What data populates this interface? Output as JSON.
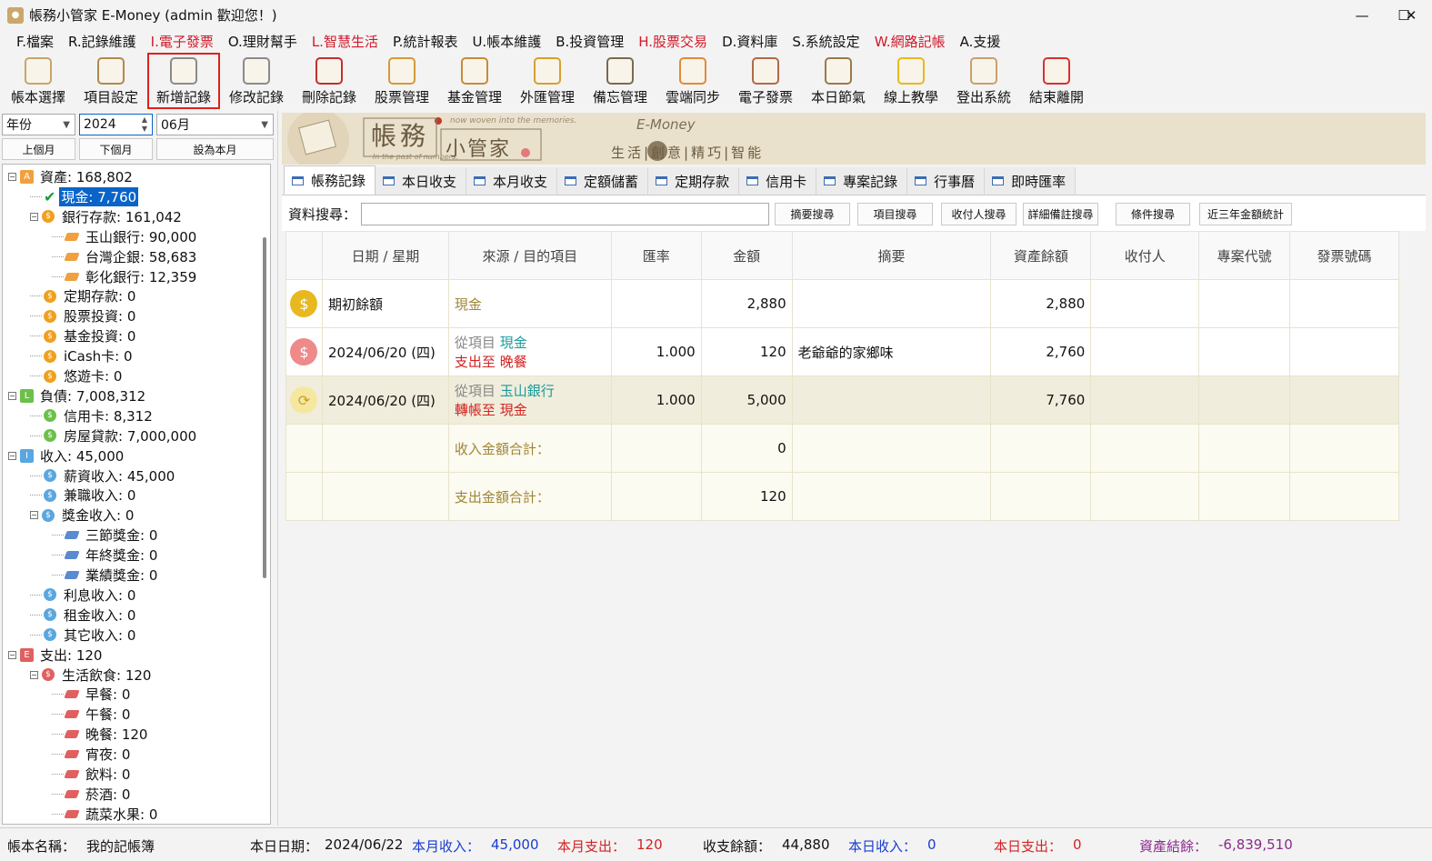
{
  "window": {
    "title": "帳務小管家 E-Money (admin 歡迎您！)",
    "minimize": "—",
    "maximize": "☐",
    "close": "✕"
  },
  "menu": [
    {
      "label": "F.檔案",
      "red": false
    },
    {
      "label": "R.記錄維護",
      "red": false
    },
    {
      "label": "I.電子發票",
      "red": true
    },
    {
      "label": "O.理財幫手",
      "red": false
    },
    {
      "label": "L.智慧生活",
      "red": true
    },
    {
      "label": "P.統計報表",
      "red": false
    },
    {
      "label": "U.帳本維護",
      "red": false
    },
    {
      "label": "B.投資管理",
      "red": false
    },
    {
      "label": "H.股票交易",
      "red": true
    },
    {
      "label": "D.資料庫",
      "red": false
    },
    {
      "label": "S.系統設定",
      "red": false
    },
    {
      "label": "W.網路記帳",
      "red": true
    },
    {
      "label": "A.支援",
      "red": false
    }
  ],
  "toolbar": [
    {
      "label": "帳本選擇",
      "icon": "ledger-icon",
      "color": "#c7a56a"
    },
    {
      "label": "項目設定",
      "icon": "gear-doc-icon",
      "color": "#b08a4a"
    },
    {
      "label": "新增記錄",
      "icon": "add-doc-icon",
      "color": "#8a8a8a"
    },
    {
      "label": "修改記錄",
      "icon": "edit-doc-icon",
      "color": "#8a8a8a"
    },
    {
      "label": "刪除記錄",
      "icon": "delete-doc-icon",
      "color": "#c03030"
    },
    {
      "label": "股票管理",
      "icon": "stock-icon",
      "color": "#d49a3a"
    },
    {
      "label": "基金管理",
      "icon": "fund-icon",
      "color": "#c88a3a"
    },
    {
      "label": "外匯管理",
      "icon": "forex-icon",
      "color": "#d8a030"
    },
    {
      "label": "備忘管理",
      "icon": "memo-icon",
      "color": "#7a6a50"
    },
    {
      "label": "雲端同步",
      "icon": "cloud-icon",
      "color": "#e08a3a"
    },
    {
      "label": "電子發票",
      "icon": "qrcode-icon",
      "color": "#b06a4a"
    },
    {
      "label": "本日節氣",
      "icon": "solar-term-icon",
      "color": "#9a7a4a"
    },
    {
      "label": "線上教學",
      "icon": "help-icon",
      "color": "#e8b820"
    },
    {
      "label": "登出系統",
      "icon": "logout-icon",
      "color": "#c8a070"
    },
    {
      "label": "結束離開",
      "icon": "exit-icon",
      "color": "#d83030"
    }
  ],
  "period": {
    "type": "年份",
    "year": "2024",
    "month": "06月",
    "prev": "上個月",
    "next": "下個月",
    "current": "設為本月"
  },
  "tree": [
    {
      "label": "資產: 168,802",
      "level": 0,
      "icon": "A",
      "color": "#f0a040",
      "exp": "−"
    },
    {
      "label": "現金: 7,760",
      "level": 1,
      "icon": "check",
      "color": "#1a9a3a",
      "hl": true
    },
    {
      "label": "銀行存款: 161,042",
      "level": 1,
      "icon": "coin",
      "color": "#f0a020",
      "exp": "−"
    },
    {
      "label": "玉山銀行: 90,000",
      "level": 2,
      "icon": "tag",
      "color": "#f0a040"
    },
    {
      "label": "台灣企銀: 58,683",
      "level": 2,
      "icon": "tag",
      "color": "#f0a040"
    },
    {
      "label": "彰化銀行: 12,359",
      "level": 2,
      "icon": "tag",
      "color": "#f0a040"
    },
    {
      "label": "定期存款: 0",
      "level": 1,
      "icon": "coin",
      "color": "#f0a020"
    },
    {
      "label": "股票投資: 0",
      "level": 1,
      "icon": "coin",
      "color": "#f0a020"
    },
    {
      "label": "基金投資: 0",
      "level": 1,
      "icon": "coin",
      "color": "#f0a020"
    },
    {
      "label": "iCash卡: 0",
      "level": 1,
      "icon": "coin",
      "color": "#f0a020"
    },
    {
      "label": "悠遊卡: 0",
      "level": 1,
      "icon": "coin",
      "color": "#f0a020"
    },
    {
      "label": "負債: 7,008,312",
      "level": 0,
      "icon": "L",
      "color": "#6cc04a",
      "exp": "−"
    },
    {
      "label": "信用卡: 8,312",
      "level": 1,
      "icon": "coin",
      "color": "#6cc04a"
    },
    {
      "label": "房屋貸款: 7,000,000",
      "level": 1,
      "icon": "coin",
      "color": "#6cc04a"
    },
    {
      "label": "收入: 45,000",
      "level": 0,
      "icon": "I",
      "color": "#5aa6e0",
      "exp": "−"
    },
    {
      "label": "薪資收入: 45,000",
      "level": 1,
      "icon": "coin",
      "color": "#5aa6e0"
    },
    {
      "label": "兼職收入: 0",
      "level": 1,
      "icon": "coin",
      "color": "#5aa6e0"
    },
    {
      "label": "獎金收入: 0",
      "level": 1,
      "icon": "coin",
      "color": "#5aa6e0",
      "exp": "−"
    },
    {
      "label": "三節獎金: 0",
      "level": 2,
      "icon": "tag",
      "color": "#5a8ad0"
    },
    {
      "label": "年終獎金: 0",
      "level": 2,
      "icon": "tag",
      "color": "#5a8ad0"
    },
    {
      "label": "業績獎金: 0",
      "level": 2,
      "icon": "tag",
      "color": "#5a8ad0"
    },
    {
      "label": "利息收入: 0",
      "level": 1,
      "icon": "coin",
      "color": "#5aa6e0"
    },
    {
      "label": "租金收入: 0",
      "level": 1,
      "icon": "coin",
      "color": "#5aa6e0"
    },
    {
      "label": "其它收入: 0",
      "level": 1,
      "icon": "coin",
      "color": "#5aa6e0"
    },
    {
      "label": "支出: 120",
      "level": 0,
      "icon": "E",
      "color": "#e06060",
      "exp": "−"
    },
    {
      "label": "生活飲食: 120",
      "level": 1,
      "icon": "coin",
      "color": "#e06060",
      "exp": "−"
    },
    {
      "label": "早餐: 0",
      "level": 2,
      "icon": "tag",
      "color": "#e06060"
    },
    {
      "label": "午餐: 0",
      "level": 2,
      "icon": "tag",
      "color": "#e06060"
    },
    {
      "label": "晚餐: 120",
      "level": 2,
      "icon": "tag",
      "color": "#e06060"
    },
    {
      "label": "宵夜: 0",
      "level": 2,
      "icon": "tag",
      "color": "#e06060"
    },
    {
      "label": "飲料: 0",
      "level": 2,
      "icon": "tag",
      "color": "#e06060"
    },
    {
      "label": "菸酒: 0",
      "level": 2,
      "icon": "tag",
      "color": "#e06060"
    },
    {
      "label": "蔬菜水果: 0",
      "level": 2,
      "icon": "tag",
      "color": "#e06060"
    }
  ],
  "banner": {
    "cn1": "帳務",
    "cn2": "小管家",
    "en1": "now woven into the memories.",
    "en2": "In the past of numbers.",
    "brand": "E-Money",
    "slogan": "生活|創意|精巧|智能"
  },
  "tabs": [
    "帳務記錄",
    "本日收支",
    "本月收支",
    "定額儲蓄",
    "定期存款",
    "信用卡",
    "專案記錄",
    "行事曆",
    "即時匯率"
  ],
  "search": {
    "label": "資料搜尋：",
    "value": "",
    "buttons": [
      "摘要搜尋",
      "項目搜尋",
      "收付人搜尋",
      "詳細備註搜尋",
      "條件搜尋",
      "近三年金額統計"
    ]
  },
  "grid": {
    "headers": [
      "",
      "日期 / 星期",
      "來源 / 目的項目",
      "匯率",
      "金額",
      "摘要",
      "資產餘額",
      "收付人",
      "專案代號",
      "發票號碼"
    ],
    "rows": [
      {
        "icon": "money-bag-icon",
        "iconColor": "#e8b820",
        "glyph": "$",
        "date": "期初餘額",
        "srcLabel": "",
        "src": "現金",
        "srcClass": "gold",
        "dstLabel": "",
        "dst": "",
        "rate": "",
        "amount": "2,880",
        "memo": "",
        "balance": "2,880",
        "alt": false
      },
      {
        "icon": "expense-coin-icon",
        "iconColor": "#ef8a8a",
        "glyph": "$",
        "date": "2024/06/20 (四)",
        "srcLabel": "從項目",
        "src": "現金",
        "srcClass": "teal",
        "dstLabel": "支出至",
        "dst": "晚餐",
        "dstClass": "red",
        "rate": "1.000",
        "amount": "120",
        "memo": "老爺爺的家鄉味",
        "balance": "2,760",
        "alt": false
      },
      {
        "icon": "transfer-icon",
        "iconColor": "#f6e7a0",
        "glyph": "⟳",
        "date": "2024/06/20 (四)",
        "srcLabel": "從項目",
        "src": "玉山銀行",
        "srcClass": "teal",
        "dstLabel": "轉帳至",
        "dst": "現金",
        "dstClass": "red",
        "rate": "1.000",
        "amount": "5,000",
        "memo": "",
        "balance": "7,760",
        "alt": true
      }
    ],
    "sums": [
      {
        "label": "收入金額合計：",
        "value": "0"
      },
      {
        "label": "支出金額合計：",
        "value": "120"
      }
    ]
  },
  "status": {
    "ledgerLabel": "帳本名稱：",
    "ledger": "我的記帳簿",
    "todayLabel": "本日日期：",
    "today": "2024/06/22",
    "monthIncomeLabel": "本月收入：",
    "monthIncome": "45,000",
    "monthExpenseLabel": "本月支出：",
    "monthExpense": "120",
    "balanceLabel": "收支餘額：",
    "balance": "44,880",
    "dayIncomeLabel": "本日收入：",
    "dayIncome": "0",
    "dayExpenseLabel": "本日支出：",
    "dayExpense": "0",
    "assetLabel": "資產結餘：",
    "asset": "-6,839,510"
  }
}
